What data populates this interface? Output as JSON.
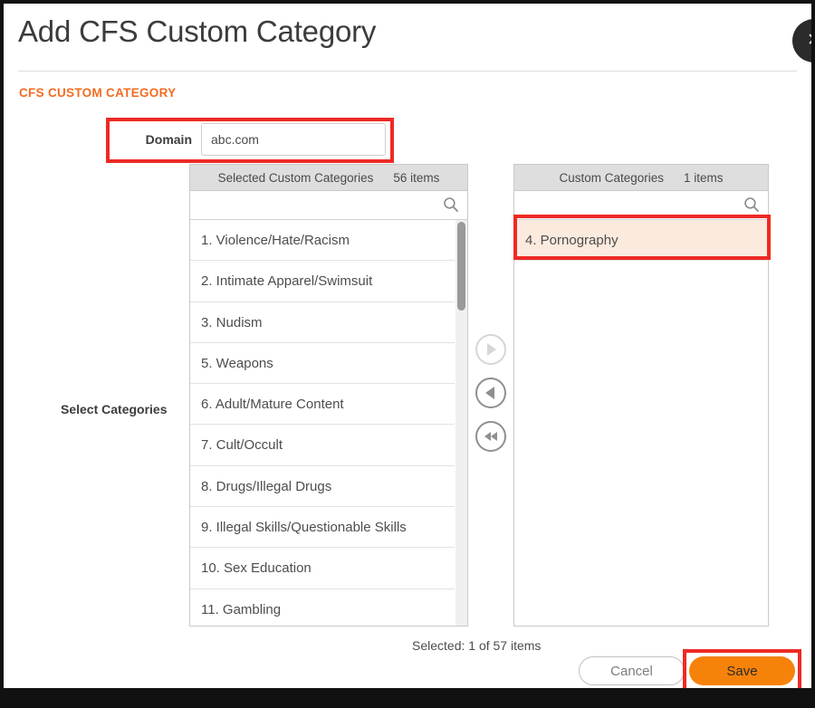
{
  "dialog": {
    "title": "Add CFS Custom Category",
    "section_label": "CFS CUSTOM CATEGORY",
    "close_icon": "close-icon"
  },
  "form": {
    "domain": {
      "label": "Domain",
      "value": "abc.com",
      "placeholder": ""
    },
    "select_categories_label": "Select Categories"
  },
  "dual_list": {
    "left_panel": {
      "title": "Selected Custom Categories",
      "count_label": "56 items",
      "search_value": "",
      "search_placeholder": "",
      "search_icon": "search-icon",
      "items": [
        {
          "label": "1. Violence/Hate/Racism",
          "selected": false
        },
        {
          "label": "2. Intimate Apparel/Swimsuit",
          "selected": false
        },
        {
          "label": "3. Nudism",
          "selected": false
        },
        {
          "label": "5. Weapons",
          "selected": false
        },
        {
          "label": "6. Adult/Mature Content",
          "selected": false
        },
        {
          "label": "7. Cult/Occult",
          "selected": false
        },
        {
          "label": "8. Drugs/Illegal Drugs",
          "selected": false
        },
        {
          "label": "9. Illegal Skills/Questionable Skills",
          "selected": false
        },
        {
          "label": "10. Sex Education",
          "selected": false
        },
        {
          "label": "11. Gambling",
          "selected": false
        }
      ]
    },
    "right_panel": {
      "title": "Custom Categories",
      "count_label": "1 items",
      "search_value": "",
      "search_placeholder": "",
      "search_icon": "search-icon",
      "items": [
        {
          "label": "4. Pornography",
          "selected": true
        }
      ]
    },
    "transfer_buttons": [
      {
        "name": "move-right-button",
        "icon": "play-right-icon",
        "enabled": false
      },
      {
        "name": "move-left-button",
        "icon": "play-left-icon",
        "enabled": true
      },
      {
        "name": "move-all-left-button",
        "icon": "double-left-icon",
        "enabled": true
      }
    ]
  },
  "footer": {
    "selected_count": "Selected: 1 of 57 items",
    "cancel_label": "Cancel",
    "save_label": "Save"
  },
  "colors": {
    "accent_orange": "#f26c21",
    "save_orange": "#f7820a",
    "annotation_red": "#ee2a24",
    "selected_row": "#fbeade"
  }
}
